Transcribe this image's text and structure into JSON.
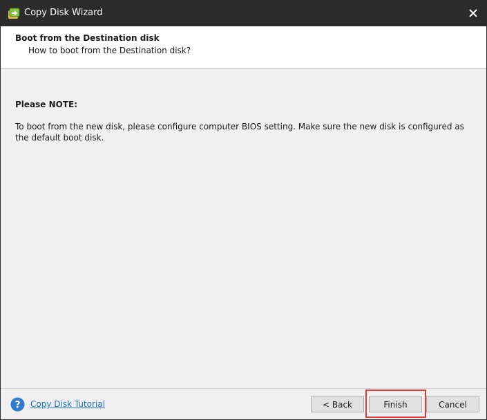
{
  "window": {
    "title": "Copy Disk Wizard",
    "icons": {
      "app": "copy-disk-wizard-app-icon",
      "close": "close-icon"
    }
  },
  "header": {
    "title": "Boot from the Destination disk",
    "subtitle": "How to boot from the Destination disk?"
  },
  "content": {
    "note_title": "Please NOTE:",
    "note_text": "To boot from the new disk, please configure computer BIOS setting. Make sure the new disk is configured as the default boot disk."
  },
  "footer": {
    "help_icon": "help-question-icon",
    "tutorial_link": "Copy Disk Tutorial",
    "back_label": "< Back",
    "finish_label": "Finish",
    "cancel_label": "Cancel",
    "highlighted_button": "Finish"
  },
  "colors": {
    "titlebar": "#2b2b2b",
    "link": "#1f6fc5",
    "highlight": "#e53935",
    "help_icon": "#2e7bcf"
  }
}
